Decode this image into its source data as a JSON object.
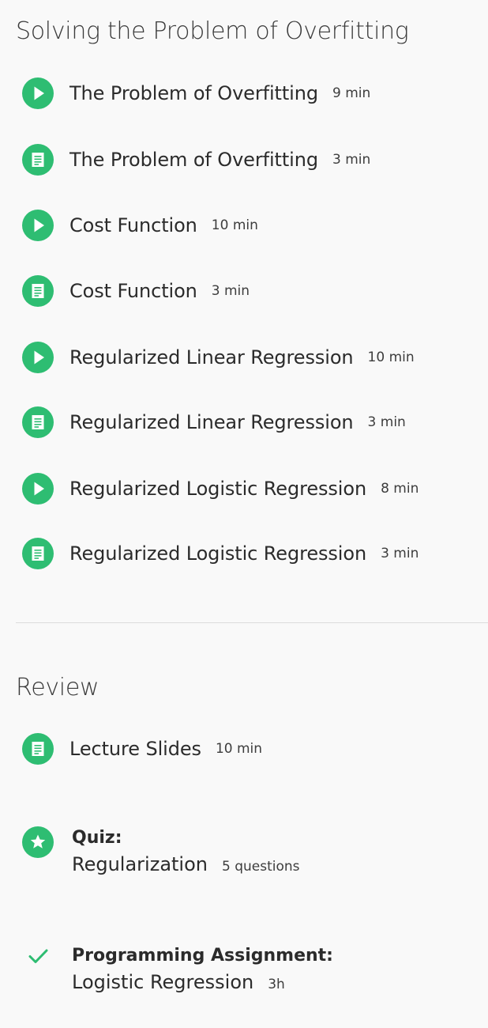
{
  "sections": [
    {
      "title": "Solving the Problem of Overfitting",
      "items": [
        {
          "type": "video",
          "label": "The Problem of Overfitting",
          "duration": "9 min"
        },
        {
          "type": "reading",
          "label": "The Problem of Overfitting",
          "duration": "3 min"
        },
        {
          "type": "video",
          "label": "Cost Function",
          "duration": "10 min"
        },
        {
          "type": "reading",
          "label": "Cost Function",
          "duration": "3 min"
        },
        {
          "type": "video",
          "label": "Regularized Linear Regression",
          "duration": "10 min"
        },
        {
          "type": "reading",
          "label": "Regularized Linear Regression",
          "duration": "3 min"
        },
        {
          "type": "video",
          "label": "Regularized Logistic Regression",
          "duration": "8 min"
        },
        {
          "type": "reading",
          "label": "Regularized Logistic Regression",
          "duration": "3 min"
        }
      ]
    },
    {
      "title": "Review",
      "items": [
        {
          "type": "reading",
          "label": "Lecture Slides",
          "duration": "10 min"
        }
      ],
      "quiz": {
        "type_label": "Quiz:",
        "name": "Regularization",
        "meta": "5 questions"
      },
      "assignment": {
        "type_label": "Programming Assignment:",
        "name": "Logistic Regression",
        "meta": "3h"
      }
    }
  ],
  "icons": {
    "video": "play-icon",
    "reading": "reading-icon",
    "quiz": "star-icon",
    "completed": "checkmark-icon"
  },
  "colors": {
    "accent": "#2ebd72",
    "background": "#f9f9f9",
    "divider": "#dcdcdc"
  }
}
